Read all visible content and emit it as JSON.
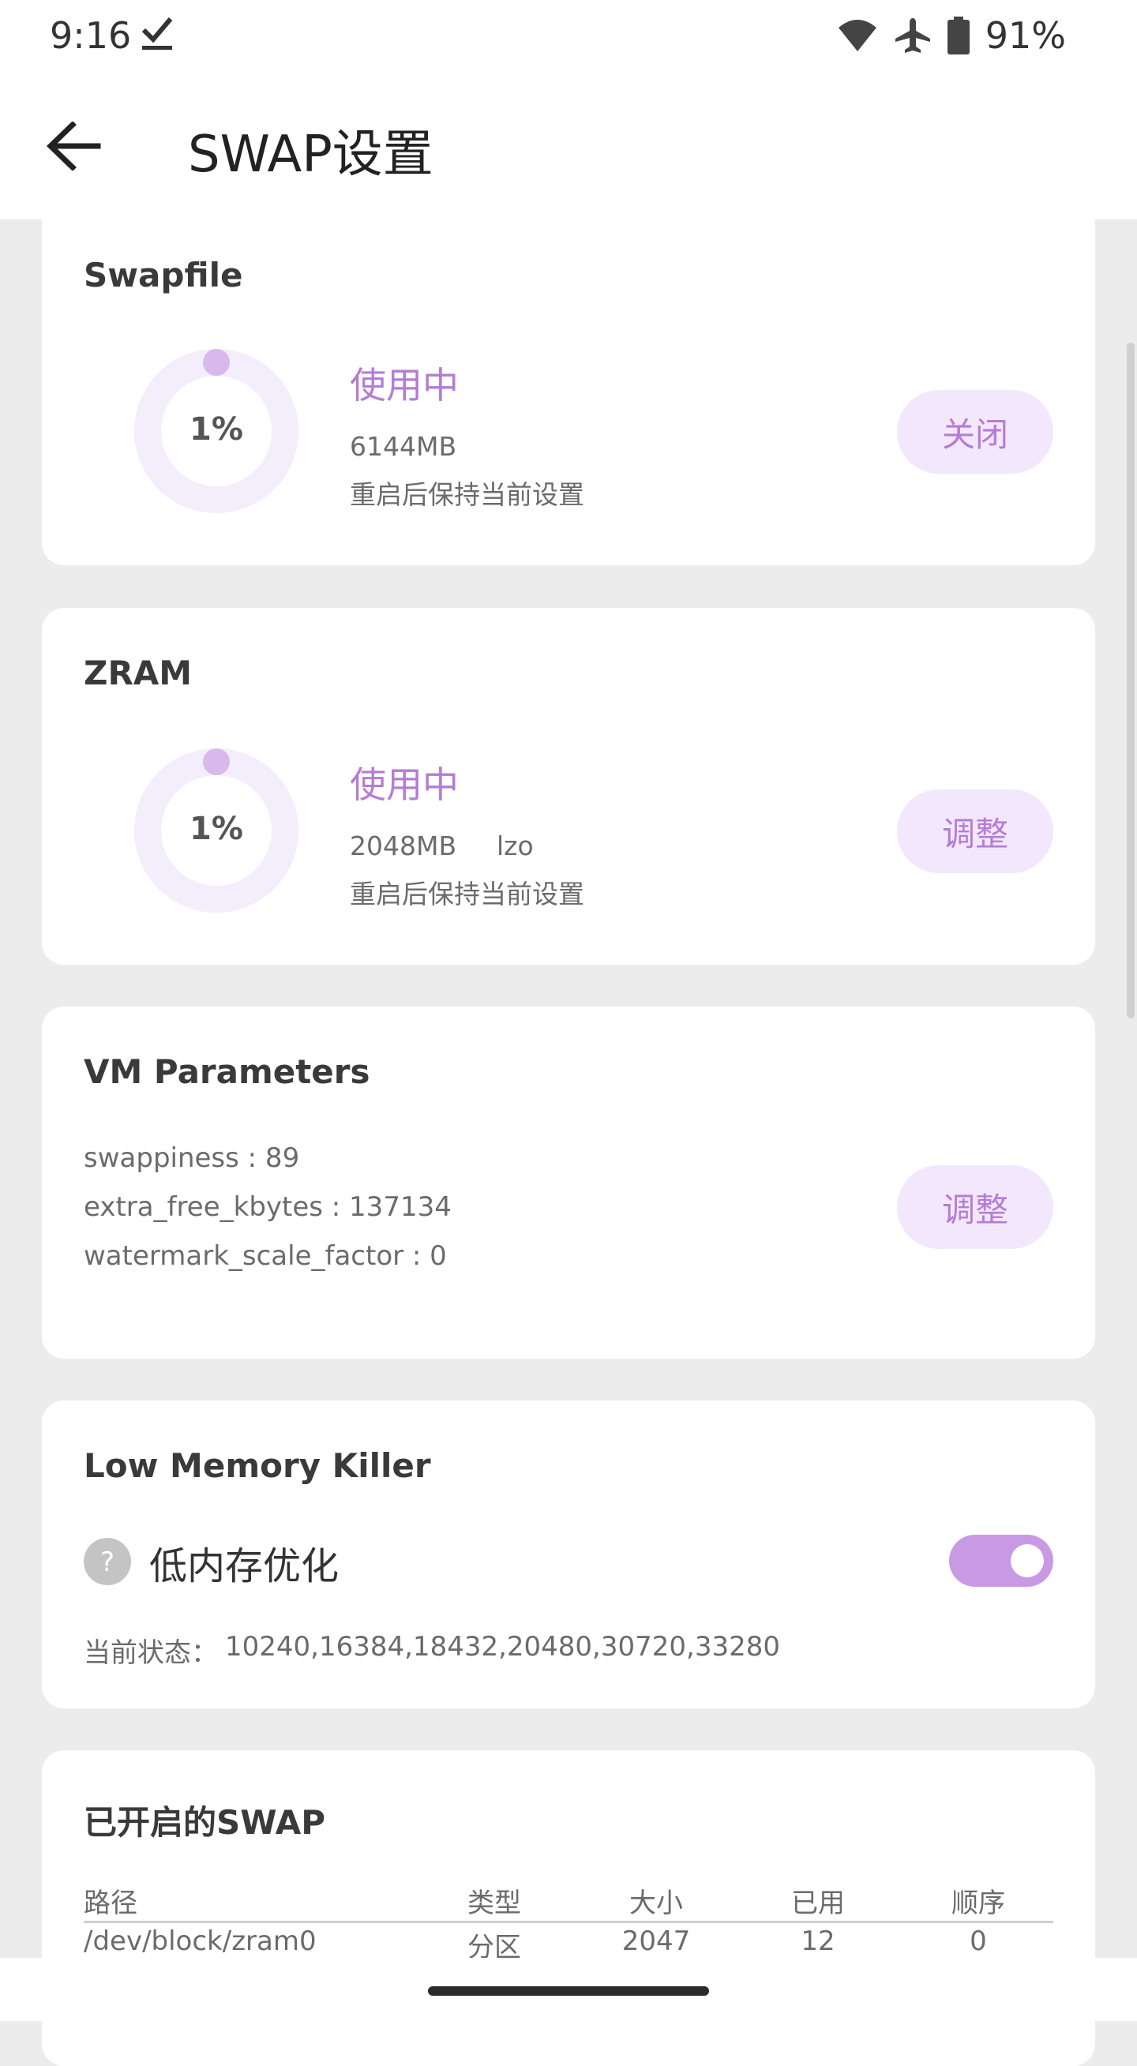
{
  "status_bar": {
    "time": "9:16",
    "battery_pct": "91%",
    "icons": [
      "download-done-icon",
      "wifi-icon",
      "airplane-icon",
      "battery-icon"
    ]
  },
  "app_bar": {
    "title": "SWAP设置",
    "back_icon": "arrow-back-icon"
  },
  "swapfile": {
    "title": "Swapfile",
    "usage_pct": "1%",
    "usage_fraction": 0.01,
    "status": "使用中",
    "size": "6144MB",
    "note": "重启后保持当前设置",
    "button": "关闭"
  },
  "zram": {
    "title": "ZRAM",
    "usage_pct": "1%",
    "usage_fraction": 0.01,
    "status": "使用中",
    "size": "2048MB",
    "algorithm": "lzo",
    "note": "重启后保持当前设置",
    "button": "调整"
  },
  "vm": {
    "title": "VM Parameters",
    "lines": [
      "swappiness : 89",
      "extra_free_kbytes : 137134",
      "watermark_scale_factor : 0"
    ],
    "button": "调整"
  },
  "lmk": {
    "title": "Low Memory Killer",
    "label": "低内存优化",
    "enabled": true,
    "state_label": "当前状态：",
    "state_value": "10240,16384,18432,20480,30720,33280"
  },
  "swaps": {
    "title": "已开启的SWAP",
    "headers": [
      "路径",
      "类型",
      "大小",
      "已用",
      "顺序"
    ],
    "rows": [
      [
        "/dev/block/zram0",
        "分区",
        "2047",
        "12",
        "0"
      ]
    ]
  },
  "colors": {
    "accent": "#b57cd6",
    "accent_light": "#f3e8fb",
    "toggle_on": "#c89ae6",
    "ring_track": "#f4edfb",
    "ring_dot": "#d9b8ee"
  }
}
